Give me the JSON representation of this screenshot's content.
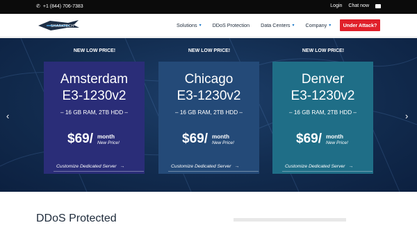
{
  "topbar": {
    "phone": "+1 (844) 706-7383",
    "login": "Login",
    "chat": "Chat now"
  },
  "nav": {
    "logo_text": "SHARKTECH",
    "items": [
      {
        "label": "Solutions"
      },
      {
        "label": "DDoS Protection"
      },
      {
        "label": "Data Centers"
      },
      {
        "label": "Company"
      }
    ],
    "attack_label": "Under Attack?"
  },
  "hero": {
    "cards": [
      {
        "badge": "NEW LOW PRICE!",
        "city": "Amsterdam",
        "model": "E3-1230v2",
        "specs": "– 16 GB RAM, 2TB HDD –",
        "price": "$69/",
        "period": "month",
        "note": "New Price!",
        "cta": "Customize Dedicated Server"
      },
      {
        "badge": "NEW LOW PRICE!",
        "city": "Chicago",
        "model": "E3-1230v2",
        "specs": "– 16 GB RAM, 2TB HDD –",
        "price": "$69/",
        "period": "month",
        "note": "New Price!",
        "cta": "Customize Dedicated Server"
      },
      {
        "badge": "NEW LOW PRICE!",
        "city": "Denver",
        "model": "E3-1230v2",
        "specs": "– 16 GB RAM, 2TB HDD –",
        "price": "$69/",
        "period": "month",
        "note": "New Price!",
        "cta": "Customize Dedicated Server"
      }
    ]
  },
  "section": {
    "heading": "DDoS Protected"
  }
}
